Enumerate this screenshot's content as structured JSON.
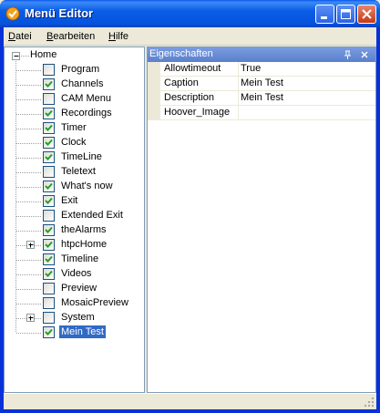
{
  "window": {
    "title": "Menü Editor"
  },
  "menubar": {
    "items": [
      {
        "prefix": "",
        "accel": "D",
        "rest": "atei"
      },
      {
        "prefix": "",
        "accel": "B",
        "rest": "earbeiten"
      },
      {
        "prefix": "",
        "accel": "H",
        "rest": "ilfe"
      }
    ]
  },
  "tree": {
    "root_label": "Home",
    "nodes": [
      {
        "label": "Program",
        "checked": false,
        "expandable": false
      },
      {
        "label": "Channels",
        "checked": true,
        "expandable": false
      },
      {
        "label": "CAM Menu",
        "checked": false,
        "expandable": false
      },
      {
        "label": "Recordings",
        "checked": true,
        "expandable": false
      },
      {
        "label": "Timer",
        "checked": true,
        "expandable": false
      },
      {
        "label": "Clock",
        "checked": true,
        "expandable": false
      },
      {
        "label": "TimeLine",
        "checked": true,
        "expandable": false
      },
      {
        "label": "Teletext",
        "checked": false,
        "expandable": false
      },
      {
        "label": "What's now",
        "checked": true,
        "expandable": false
      },
      {
        "label": "Exit",
        "checked": true,
        "expandable": false
      },
      {
        "label": "Extended Exit",
        "checked": false,
        "expandable": false
      },
      {
        "label": "theAlarms",
        "checked": true,
        "expandable": false
      },
      {
        "label": "htpcHome",
        "checked": true,
        "expandable": true
      },
      {
        "label": "Timeline",
        "checked": true,
        "expandable": false
      },
      {
        "label": "Videos",
        "checked": true,
        "expandable": false
      },
      {
        "label": "Preview",
        "checked": false,
        "expandable": false
      },
      {
        "label": "MosaicPreview",
        "checked": false,
        "expandable": false
      },
      {
        "label": "System",
        "checked": false,
        "expandable": true
      },
      {
        "label": "Mein Test",
        "checked": true,
        "expandable": false,
        "selected": true
      }
    ]
  },
  "properties": {
    "title": "Eigenschaften",
    "rows": [
      {
        "name": "Allowtimeout",
        "value": "True"
      },
      {
        "name": "Caption",
        "value": "Mein Test"
      },
      {
        "name": "Description",
        "value": "Mein Test"
      },
      {
        "name": "Hoover_Image",
        "value": ""
      }
    ]
  },
  "colors": {
    "titlebar": "#0a5ce6",
    "selection": "#316ac5",
    "check": "#21a121"
  }
}
